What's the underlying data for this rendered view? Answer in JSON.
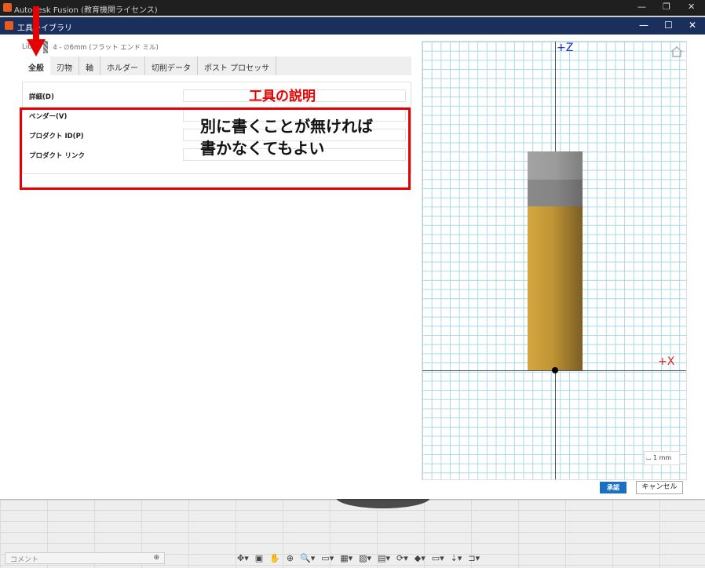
{
  "parent_window": {
    "title": "Autodesk Fusion (教育機関ライセンス)",
    "controls": [
      "—",
      "❐",
      "✕"
    ]
  },
  "dialog": {
    "title": "工具ライブラリ",
    "controls": [
      "—",
      "☐",
      "✕"
    ]
  },
  "breadcrumb": {
    "root": "Lib",
    "separator": "/",
    "tool": "4 - ∅6mm (フラット エンド ミル)"
  },
  "tabs": [
    {
      "label": "全般",
      "active": true
    },
    {
      "label": "刃物",
      "active": false
    },
    {
      "label": "軸",
      "active": false
    },
    {
      "label": "ホルダー",
      "active": false
    },
    {
      "label": "切削データ",
      "active": false
    },
    {
      "label": "ポスト プロセッサ",
      "active": false
    }
  ],
  "form": {
    "detail_label": "詳細(D)",
    "detail_value": "",
    "vendor_label": "ベンダー(V)",
    "vendor_value": "",
    "product_id_label": "プロダクト ID(P)",
    "product_id_value": "",
    "product_link_label": "プロダクト リンク",
    "product_link_value": ""
  },
  "annotation": {
    "title": "工具の説明",
    "line1": "別に書くことが無ければ",
    "line2": "書かなくてもよい",
    "color": "#e60000"
  },
  "viewport": {
    "z_label": "+Z",
    "x_label": "+X",
    "scale_label": "1 mm",
    "grid_color": "#a8d9e6"
  },
  "buttons": {
    "ok": "承認",
    "cancel": "キャンセル",
    "ok_color": "#1d6fc1"
  },
  "bottom": {
    "comment_placeholder": "コメント",
    "comment_plus": "⊕",
    "toolbar_icons": [
      "✥▾",
      "▣",
      "✋",
      "⊕",
      "🔍▾",
      "▭▾",
      "▦▾",
      "▨▾",
      "▤▾",
      "⟳▾",
      "◆▾",
      "▭▾",
      "⇣▾",
      "⊐▾"
    ]
  }
}
